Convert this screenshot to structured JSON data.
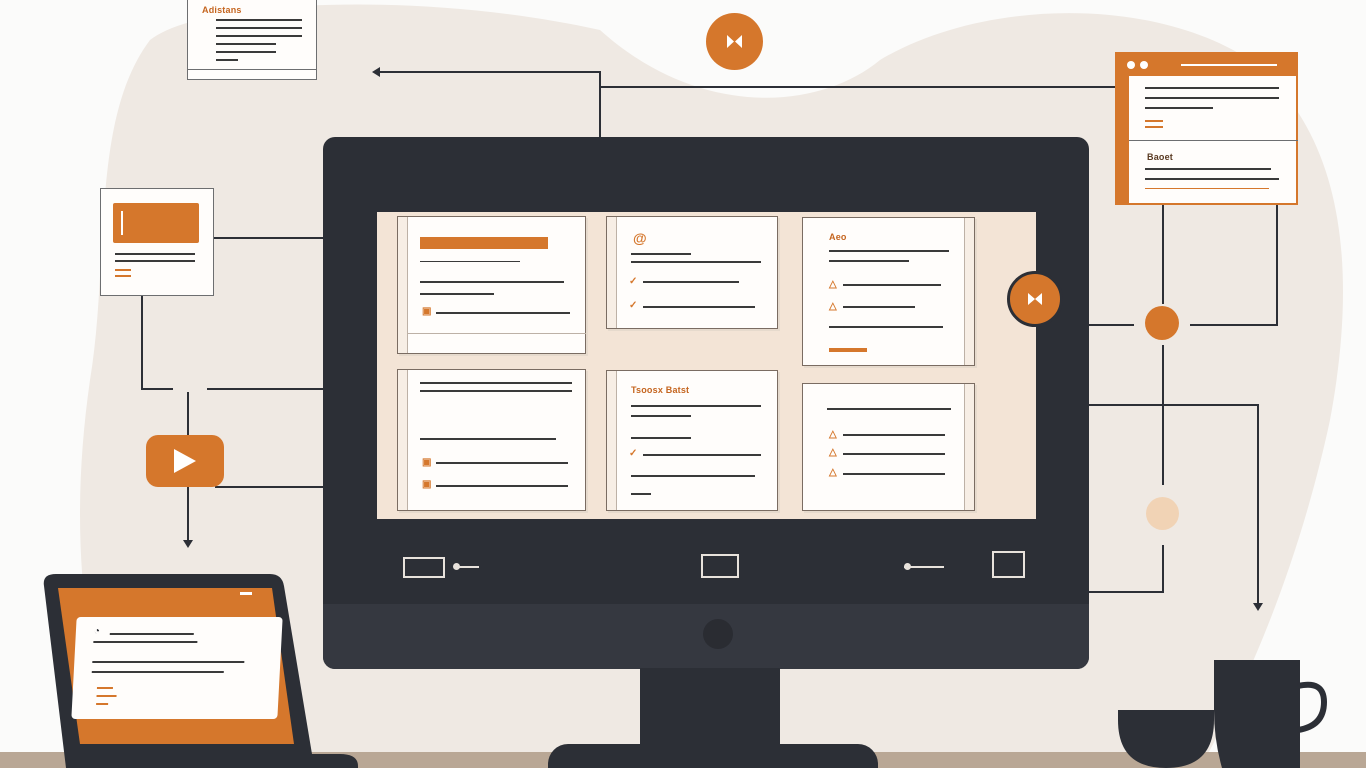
{
  "colors": {
    "accent": "#d5772c",
    "dark": "#2c2f36",
    "blob": "#efe9e3",
    "screen": "#f3e4d6"
  },
  "labels": {
    "top_note": "Adistans",
    "card_3": "Aeo",
    "card_5": "Tsoosx Batst",
    "right_window": "Baoet"
  },
  "icons": [
    "skip-icon",
    "play-icon",
    "warning-icon",
    "checkmark-icon",
    "swirl-icon",
    "calendar-icon"
  ]
}
